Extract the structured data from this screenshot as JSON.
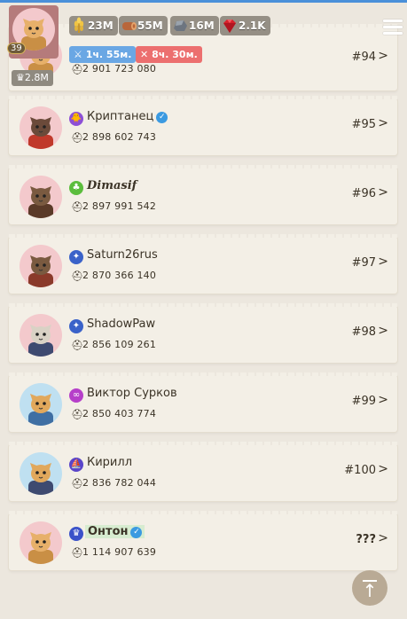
{
  "hud": {
    "level": "39",
    "crown_value": "♛2.8M",
    "resources": [
      {
        "name": "gold",
        "icon": "wheat-icon",
        "value": "23M",
        "color": "#e3b43a"
      },
      {
        "name": "wood",
        "icon": "log-icon",
        "value": "55M",
        "color": "#b8663a"
      },
      {
        "name": "stone",
        "icon": "stone-icon",
        "value": "16M",
        "color": "#6d7580"
      },
      {
        "name": "gems",
        "icon": "ruby-icon",
        "value": "2.1K",
        "color": "#d8202a"
      }
    ],
    "timers": [
      {
        "icon": "sword-icon",
        "text": "1ч. 55м.",
        "color": "#6aa7e4"
      },
      {
        "icon": "crossed-swords-icon",
        "text": "8ч. 30м.",
        "color": "#ec6f6f"
      }
    ]
  },
  "players": [
    {
      "name": "",
      "power": "2 901 723 080",
      "rank": "#94",
      "badge_color": "#e0a93b",
      "verified": false,
      "style": "normal",
      "avatar": "cat-ginger-armor"
    },
    {
      "name": "Криптанец",
      "power": "2 898 602 743",
      "rank": "#95",
      "badge_color": "#8d4fd6",
      "badge_icon": "chick-icon",
      "verified": true,
      "style": "normal",
      "avatar": "cat-red-hood"
    },
    {
      "name": "Dimasif",
      "power": "2 897 991 542",
      "rank": "#96",
      "badge_color": "#5bbd3c",
      "badge_icon": "tree-icon",
      "verified": false,
      "style": "gothic",
      "avatar": "cat-brown"
    },
    {
      "name": "Saturn26rus",
      "power": "2 870 366 140",
      "rank": "#97",
      "badge_color": "#3a62c9",
      "badge_icon": "satellite-icon",
      "verified": false,
      "style": "normal",
      "avatar": "cat-brown-2"
    },
    {
      "name": "ShadowPaw",
      "power": "2 856 109 261",
      "rank": "#98",
      "badge_color": "#3a62c9",
      "badge_icon": "satellite-icon",
      "verified": false,
      "style": "normal",
      "avatar": "cat-grumpy"
    },
    {
      "name": "Виктор Сурков",
      "power": "2 850 403 774",
      "rank": "#99",
      "badge_color": "#b63fc9",
      "badge_icon": "glasses-icon",
      "verified": false,
      "style": "normal",
      "avatar": "doge-blue"
    },
    {
      "name": "Кирилл",
      "power": "2 836 782 044",
      "rank": "#100",
      "badge_color": "#5a45c9",
      "badge_icon": "boat-icon",
      "verified": false,
      "style": "normal",
      "avatar": "doge-knight"
    },
    {
      "name": "Онтон",
      "power": "1 114 907 639",
      "rank": "???",
      "badge_color": "#3a52c9",
      "badge_icon": "crown-icon",
      "verified": true,
      "style": "highlight",
      "avatar": "cat-ginger-armor"
    }
  ]
}
